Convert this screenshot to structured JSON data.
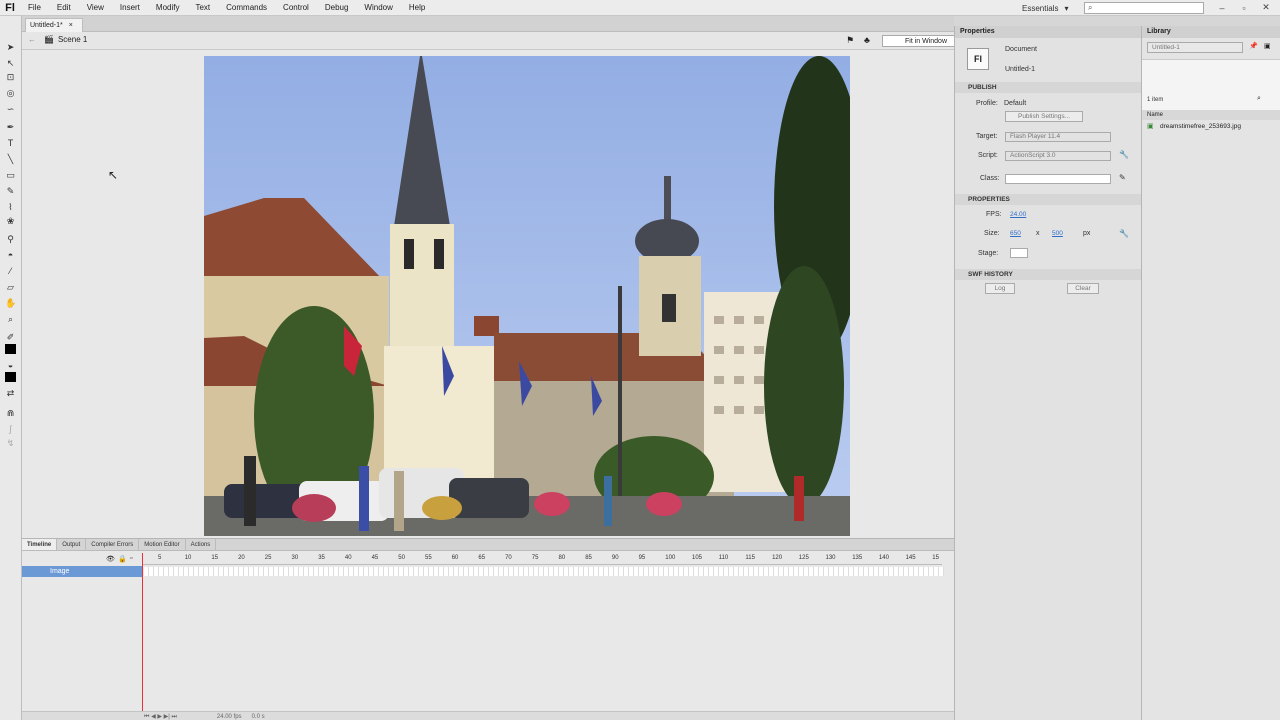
{
  "app": {
    "logo": "Fl",
    "workspace": "Essentials",
    "search_placeholder": ""
  },
  "menu": [
    "File",
    "Edit",
    "View",
    "Insert",
    "Modify",
    "Text",
    "Commands",
    "Control",
    "Debug",
    "Window",
    "Help"
  ],
  "document": {
    "tab_title": "Untitled-1*",
    "scene": "Scene 1",
    "zoom": "Fit in Window"
  },
  "timeline": {
    "tabs": [
      "Timeline",
      "Output",
      "Compiler Errors",
      "Motion Editor",
      "Actions"
    ],
    "frame_numbers": [
      "5",
      "10",
      "15",
      "20",
      "25",
      "30",
      "35",
      "40",
      "45",
      "50",
      "55",
      "60",
      "65",
      "70",
      "75",
      "80",
      "85",
      "90",
      "95",
      "100",
      "105",
      "110",
      "115",
      "120",
      "125",
      "130",
      "135",
      "140",
      "145",
      "15"
    ],
    "layer_name": "Image",
    "footer_fps": "24.00 fps",
    "footer_time": "0.0 s"
  },
  "properties": {
    "tab": "Properties",
    "doc_icon": "Fl",
    "doc_type": "Document",
    "doc_name": "Untitled-1",
    "publish_head": "PUBLISH",
    "profile_label": "Profile:",
    "profile_value": "Default",
    "publish_settings": "Publish Settings...",
    "target_label": "Target:",
    "target_value": "Flash Player 11.4",
    "script_label": "Script:",
    "script_value": "ActionScript 3.0",
    "class_label": "Class:",
    "properties_head": "PROPERTIES",
    "fps_label": "FPS:",
    "fps_value": "24.00",
    "size_label": "Size:",
    "width_value": "650",
    "x_sep": "x",
    "height_value": "500",
    "unit": "px",
    "stage_label": "Stage:",
    "swf_head": "SWF HISTORY",
    "log_btn": "Log",
    "clear_btn": "Clear"
  },
  "library": {
    "tab": "Library",
    "doc_select": "Untitled-1",
    "item_count": "1 item",
    "col_name": "Name",
    "items": [
      "dreamstimefree_253693.jpg"
    ]
  }
}
